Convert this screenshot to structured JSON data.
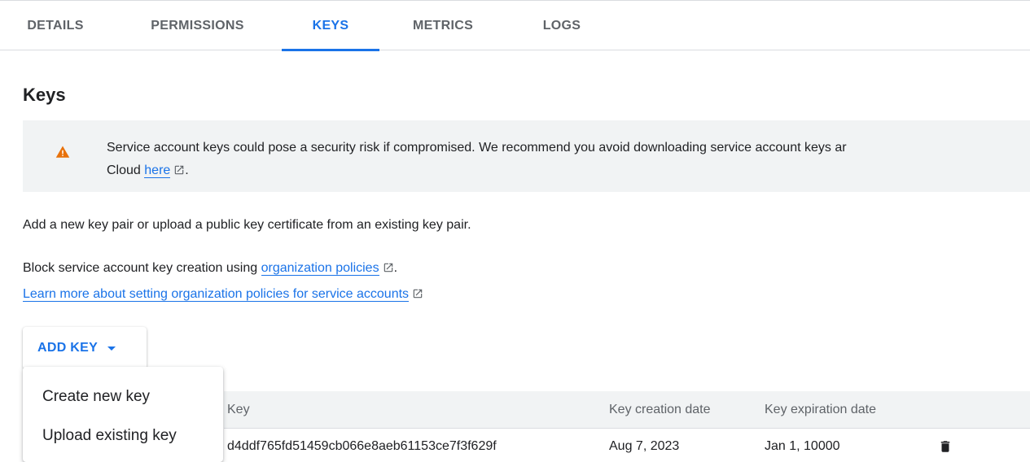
{
  "tabs": [
    {
      "label": "DETAILS"
    },
    {
      "label": "PERMISSIONS"
    },
    {
      "label": "KEYS",
      "active": true
    },
    {
      "label": "METRICS"
    },
    {
      "label": "LOGS"
    }
  ],
  "page_title": "Keys",
  "warning": {
    "text": "Service account keys could pose a security risk if compromised. We recommend you avoid downloading service account keys ar",
    "text_line2": "Cloud",
    "link": "here",
    "after_link": ".",
    "icon": "warning-triangle-icon",
    "icon_color": "#e8710a"
  },
  "intro_text": "Add a new key pair or upload a public key certificate from an existing key pair.",
  "policy": {
    "prefix": "Block service account key creation using",
    "link": "organization policies",
    "suffix": ".",
    "learn_more": "Learn more about setting organization policies for service accounts"
  },
  "add_key_button": "ADD KEY",
  "menu": {
    "items": [
      "Create new key",
      "Upload existing key"
    ]
  },
  "table": {
    "headers": [
      "Key",
      "Key creation date",
      "Key expiration date"
    ],
    "rows": [
      {
        "key": "d4ddf765fd51459cb066e8aeb61153ce7f3f629f",
        "created": "Aug 7, 2023",
        "expires": "Jan 1, 10000"
      }
    ]
  },
  "colors": {
    "accent": "#1a73e8",
    "warning": "#e8710a",
    "surface": "#f1f3f4"
  }
}
